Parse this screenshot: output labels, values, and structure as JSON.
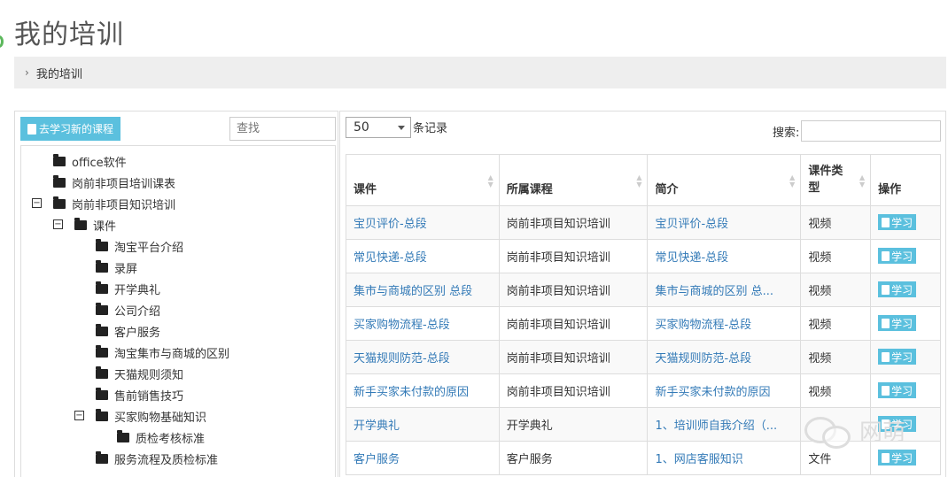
{
  "page": {
    "title": "我的培训"
  },
  "breadcrumb": {
    "chevron": "›",
    "label": "我的培训"
  },
  "left_panel": {
    "learn_new_label": "去学习新的课程",
    "search_placeholder": "查找",
    "tree": [
      {
        "label": "office软件",
        "toggle": ""
      },
      {
        "label": "岗前非项目培训课表",
        "toggle": ""
      },
      {
        "label": "岗前非项目知识培训",
        "toggle": "−"
      },
      {
        "label": "课件",
        "toggle": "−"
      },
      {
        "label": "淘宝平台介绍",
        "toggle": ""
      },
      {
        "label": "录屏",
        "toggle": ""
      },
      {
        "label": "开学典礼",
        "toggle": ""
      },
      {
        "label": "公司介绍",
        "toggle": ""
      },
      {
        "label": "客户服务",
        "toggle": ""
      },
      {
        "label": "淘宝集市与商城的区别",
        "toggle": ""
      },
      {
        "label": "天猫规则须知",
        "toggle": ""
      },
      {
        "label": "售前销售技巧",
        "toggle": ""
      },
      {
        "label": "买家购物基础知识",
        "toggle": "−"
      },
      {
        "label": "质检考核标准",
        "toggle": ""
      },
      {
        "label": "服务流程及质检标准",
        "toggle": ""
      }
    ]
  },
  "right_panel": {
    "length_value": "50",
    "length_suffix": "条记录",
    "search_label": "搜索:",
    "columns": [
      "课件",
      "所属课程",
      "简介",
      "课件类型",
      "操作"
    ],
    "study_label": "学习",
    "rows": [
      {
        "courseware": "宝贝评价-总段",
        "course": "岗前非项目知识培训",
        "intro": "宝贝评价-总段",
        "type": "视频"
      },
      {
        "courseware": "常见快递-总段",
        "course": "岗前非项目知识培训",
        "intro": "常见快递-总段",
        "type": "视频"
      },
      {
        "courseware": "集市与商城的区别 总段",
        "course": "岗前非项目知识培训",
        "intro": "集市与商城的区别 总...",
        "type": "视频"
      },
      {
        "courseware": "买家购物流程-总段",
        "course": "岗前非项目知识培训",
        "intro": "买家购物流程-总段",
        "type": "视频"
      },
      {
        "courseware": "天猫规则防范-总段",
        "course": "岗前非项目知识培训",
        "intro": "天猫规则防范-总段",
        "type": "视频"
      },
      {
        "courseware": "新手买家未付款的原因",
        "course": "岗前非项目知识培训",
        "intro": "新手买家未付款的原因",
        "type": "视频"
      },
      {
        "courseware": "开学典礼",
        "course": "开学典礼",
        "intro": "1、培训师自我介绍（...",
        "type": ""
      },
      {
        "courseware": "客户服务",
        "course": "客户服务",
        "intro": "1、网店客服知识",
        "type": "文件"
      }
    ]
  },
  "watermark": {
    "text": "网萌"
  },
  "colors": {
    "accent": "#5bc0de",
    "link": "#337ab7",
    "border": "#dddddd",
    "breadcrumb_bg": "#eeeeee"
  }
}
